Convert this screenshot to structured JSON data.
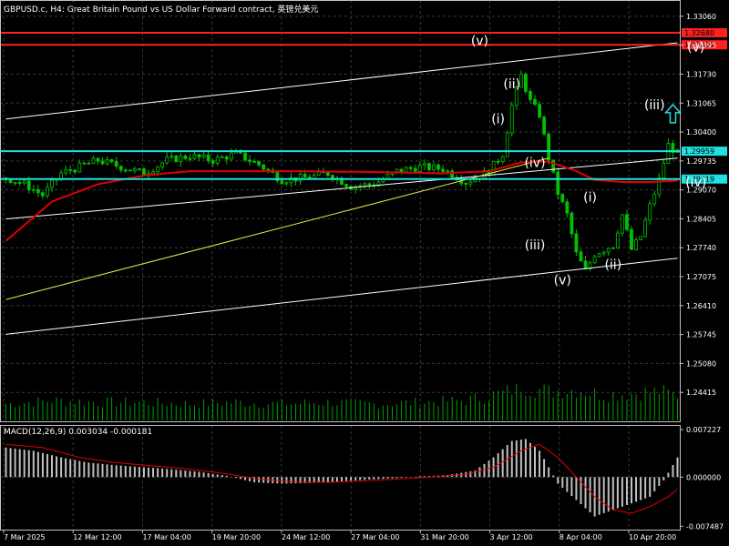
{
  "header": {
    "title": "GBPUSD.c, H4:  Great Britain Pound vs US Dollar Forward contract, 英镑兑美元"
  },
  "macd": {
    "title": "MACD(12,26,9) 0.003034 -0.000181"
  },
  "colors": {
    "background": "#000000",
    "candles": "#00c000",
    "volume": "#00a000",
    "ma": "#e00000",
    "signal": "#e00000",
    "hist": "#c0c0c0",
    "red_level": "#ff2020",
    "cyan_level": "#20e0e0",
    "channel": "#ffffff",
    "trend": "#e6e64a",
    "arrow": "#20e0e0"
  },
  "chart_data": {
    "type": "candlestick",
    "ylim": [
      1.2375,
      1.3335
    ],
    "y_ticks": [
      "1.33060",
      "1.32395",
      "1.31730",
      "1.31065",
      "1.30400",
      "1.29735",
      "1.29070",
      "1.28405",
      "1.27740",
      "1.27075",
      "1.26410",
      "1.25745",
      "1.25080",
      "1.24415"
    ],
    "x_ticks": [
      "7 Mar 2025",
      "12 Mar 12:00",
      "17 Mar 04:00",
      "19 Mar 20:00",
      "24 Mar 12:00",
      "27 Mar 04:00",
      "31 Mar 20:00",
      "3 Apr 12:00",
      "8 Apr 04:00",
      "10 Apr 20:00"
    ],
    "bar_count": 147,
    "levels": [
      {
        "price": 1.3268,
        "label": "1.32680",
        "color": "#ff2020"
      },
      {
        "price": 1.32404,
        "label": "1.32404",
        "color": "#ff2020"
      },
      {
        "price": 1.29959,
        "label": "1.29959",
        "color": "#20e0e0"
      },
      {
        "price": 1.29319,
        "label": "1.29319",
        "color": "#20e0e0"
      }
    ],
    "close_path": [
      [
        0,
        1.2935
      ],
      [
        4,
        1.292
      ],
      [
        8,
        1.2895
      ],
      [
        12,
        1.2945
      ],
      [
        16,
        1.296
      ],
      [
        20,
        1.2975
      ],
      [
        25,
        1.296
      ],
      [
        30,
        1.2945
      ],
      [
        35,
        1.2975
      ],
      [
        40,
        1.2985
      ],
      [
        45,
        1.2975
      ],
      [
        50,
        1.299
      ],
      [
        55,
        1.2965
      ],
      [
        60,
        1.293
      ],
      [
        65,
        1.2935
      ],
      [
        70,
        1.2945
      ],
      [
        75,
        1.2915
      ],
      [
        80,
        1.292
      ],
      [
        85,
        1.295
      ],
      [
        90,
        1.296
      ],
      [
        95,
        1.2955
      ],
      [
        100,
        1.2925
      ],
      [
        105,
        1.295
      ],
      [
        108,
        1.299
      ],
      [
        110,
        1.31
      ],
      [
        112,
        1.317
      ],
      [
        114,
        1.311
      ],
      [
        116,
        1.308
      ],
      [
        118,
        1.298
      ],
      [
        120,
        1.29
      ],
      [
        122,
        1.285
      ],
      [
        124,
        1.276
      ],
      [
        126,
        1.272
      ],
      [
        128,
        1.276
      ],
      [
        130,
        1.277
      ],
      [
        132,
        1.278
      ],
      [
        134,
        1.285
      ],
      [
        136,
        1.277
      ],
      [
        138,
        1.28
      ],
      [
        140,
        1.287
      ],
      [
        142,
        1.293
      ],
      [
        144,
        1.301
      ],
      [
        146,
        1.299
      ]
    ],
    "ma_path": [
      [
        0,
        1.279
      ],
      [
        10,
        1.288
      ],
      [
        20,
        1.292
      ],
      [
        30,
        1.294
      ],
      [
        40,
        1.295
      ],
      [
        50,
        1.295
      ],
      [
        60,
        1.295
      ],
      [
        80,
        1.2948
      ],
      [
        95,
        1.2945
      ],
      [
        105,
        1.295
      ],
      [
        112,
        1.297
      ],
      [
        118,
        1.2972
      ],
      [
        124,
        1.295
      ],
      [
        128,
        1.293
      ],
      [
        134,
        1.2925
      ],
      [
        140,
        1.2925
      ],
      [
        146,
        1.2928
      ]
    ],
    "lines": [
      {
        "name": "upper-channel",
        "color": "#ffffff",
        "from": [
          0,
          1.307
        ],
        "to": [
          146,
          1.3245
        ]
      },
      {
        "name": "middle-channel",
        "color": "#ffffff",
        "from": [
          0,
          1.284
        ],
        "to": [
          146,
          1.298
        ]
      },
      {
        "name": "lower-channel",
        "color": "#ffffff",
        "from": [
          0,
          1.2575
        ],
        "to": [
          146,
          1.275
        ]
      },
      {
        "name": "trend-line",
        "color": "#e6e64a",
        "from": [
          0,
          1.2655
        ],
        "to": [
          118,
          1.298
        ]
      }
    ],
    "wave_labels": [
      {
        "text": "(v)",
        "bar": 103,
        "price": 1.324
      },
      {
        "text": "(ii)",
        "bar": 110,
        "price": 1.314
      },
      {
        "text": "(i)",
        "bar": 107,
        "price": 1.306
      },
      {
        "text": "(iv)",
        "bar": 115,
        "price": 1.296
      },
      {
        "text": "(iii)",
        "bar": 115,
        "price": 1.277
      },
      {
        "text": "(v)",
        "bar": 121,
        "price": 1.269
      },
      {
        "text": "(i)",
        "bar": 127,
        "price": 1.288
      },
      {
        "text": "(ii)",
        "bar": 132,
        "price": 1.2725
      },
      {
        "text": "(iii)",
        "bar": 141,
        "price": 1.3092
      },
      {
        "text": "(v)",
        "bar": 150,
        "price": 1.3225
      },
      {
        "text": "(iv)",
        "bar": 150,
        "price": 1.2915
      }
    ],
    "arrow": {
      "bar": 145,
      "price": 1.308,
      "direction": "up"
    },
    "volume_path": [
      [
        0,
        0.45
      ],
      [
        10,
        0.55
      ],
      [
        20,
        0.5
      ],
      [
        30,
        0.5
      ],
      [
        40,
        0.45
      ],
      [
        50,
        0.5
      ],
      [
        60,
        0.45
      ],
      [
        70,
        0.5
      ],
      [
        80,
        0.45
      ],
      [
        90,
        0.5
      ],
      [
        100,
        0.55
      ],
      [
        108,
        0.75
      ],
      [
        112,
        0.95
      ],
      [
        118,
        0.8
      ],
      [
        124,
        0.85
      ],
      [
        130,
        0.7
      ],
      [
        136,
        0.75
      ],
      [
        142,
        0.8
      ],
      [
        146,
        0.7
      ]
    ]
  },
  "macd_data": {
    "ylim": [
      -0.008,
      0.0078
    ],
    "y_ticks": [
      "0.007227",
      "0.000000",
      "-0.007487"
    ],
    "hist_path": [
      [
        0,
        0.0045
      ],
      [
        6,
        0.004
      ],
      [
        12,
        0.003
      ],
      [
        18,
        0.0022
      ],
      [
        24,
        0.0018
      ],
      [
        30,
        0.0015
      ],
      [
        36,
        0.0012
      ],
      [
        42,
        0.0008
      ],
      [
        48,
        0.0002
      ],
      [
        54,
        -0.0008
      ],
      [
        60,
        -0.001
      ],
      [
        66,
        -0.0009
      ],
      [
        72,
        -0.0007
      ],
      [
        78,
        -0.0004
      ],
      [
        84,
        -0.0002
      ],
      [
        90,
        0.0001
      ],
      [
        96,
        0.0003
      ],
      [
        102,
        0.001
      ],
      [
        106,
        0.003
      ],
      [
        110,
        0.0055
      ],
      [
        113,
        0.0058
      ],
      [
        116,
        0.004
      ],
      [
        120,
        -0.001
      ],
      [
        124,
        -0.0035
      ],
      [
        128,
        -0.006
      ],
      [
        132,
        -0.005
      ],
      [
        136,
        -0.004
      ],
      [
        140,
        -0.003
      ],
      [
        143,
        -0.0005
      ],
      [
        146,
        0.003
      ]
    ],
    "signal_path": [
      [
        0,
        0.005
      ],
      [
        8,
        0.0045
      ],
      [
        16,
        0.003
      ],
      [
        24,
        0.0022
      ],
      [
        32,
        0.0017
      ],
      [
        40,
        0.0012
      ],
      [
        48,
        0.0005
      ],
      [
        54,
        -0.0002
      ],
      [
        62,
        -0.0007
      ],
      [
        70,
        -0.0008
      ],
      [
        80,
        -0.0005
      ],
      [
        90,
        -0.0001
      ],
      [
        100,
        0.0004
      ],
      [
        106,
        0.0015
      ],
      [
        112,
        0.004
      ],
      [
        116,
        0.005
      ],
      [
        120,
        0.003
      ],
      [
        124,
        0.0
      ],
      [
        128,
        -0.003
      ],
      [
        132,
        -0.005
      ],
      [
        136,
        -0.0055
      ],
      [
        140,
        -0.0045
      ],
      [
        144,
        -0.003
      ],
      [
        146,
        -0.0018
      ]
    ]
  }
}
